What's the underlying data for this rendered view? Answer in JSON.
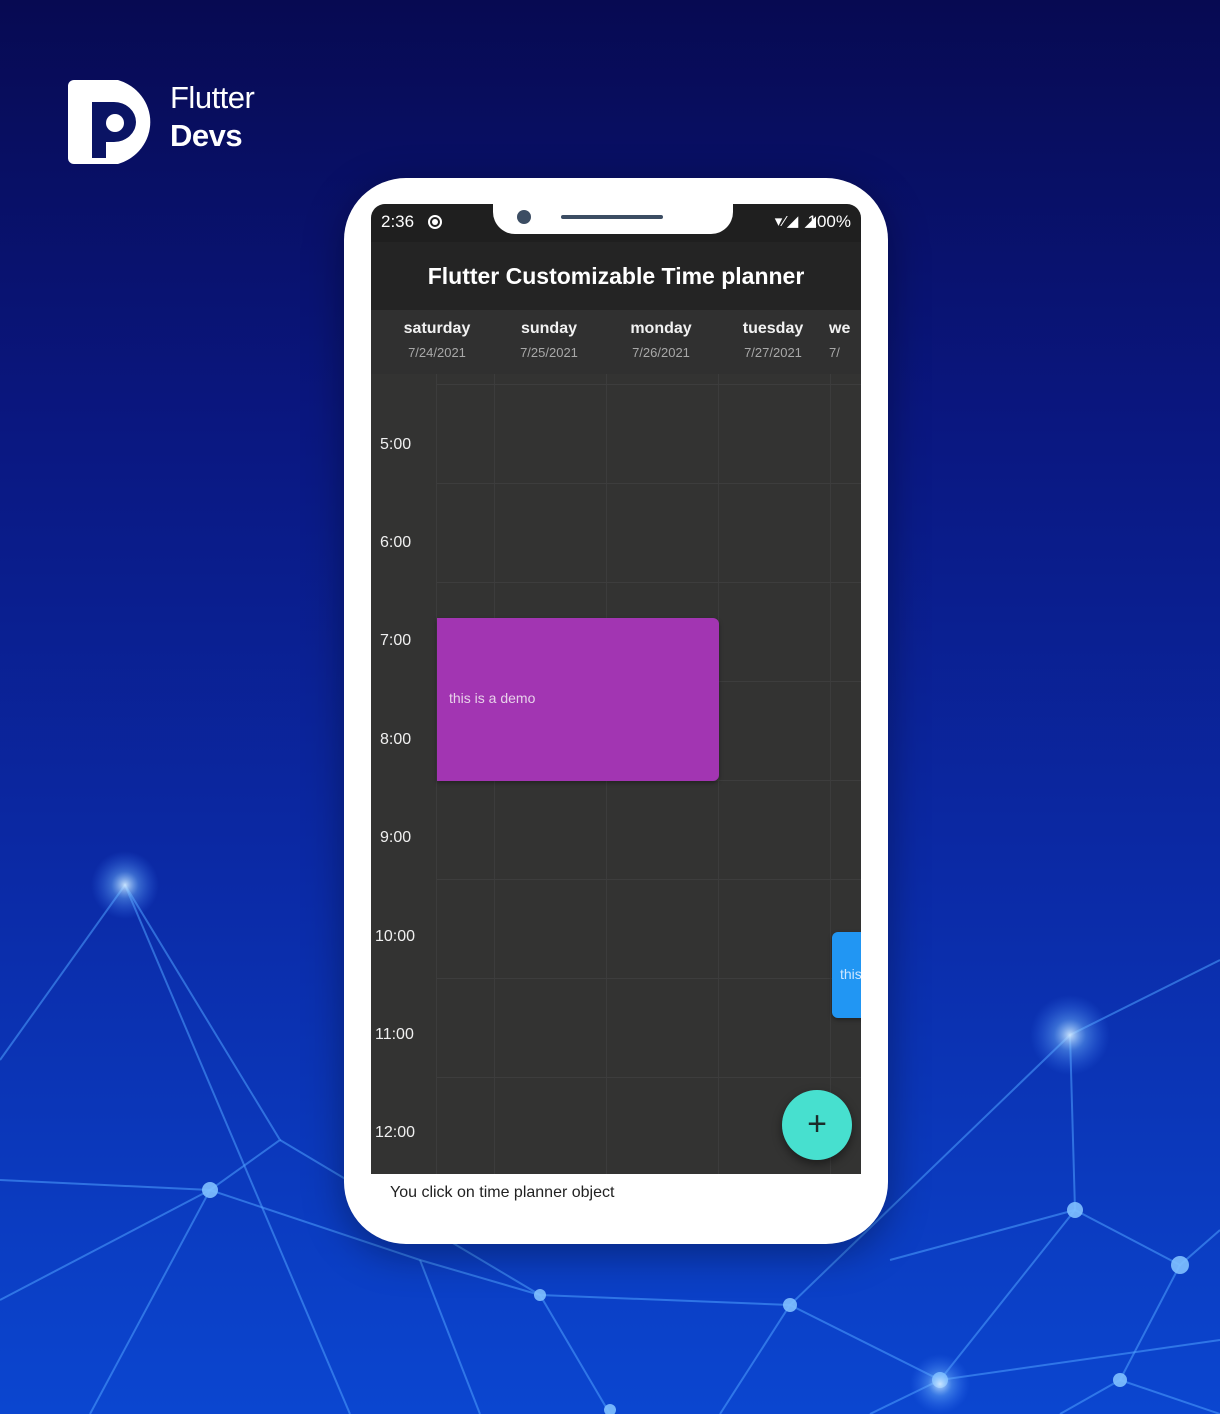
{
  "brand": {
    "line1": "Flutter",
    "line2": "Devs"
  },
  "status_bar": {
    "time": "2:36",
    "signal_icons": "▾⁄◢ ◢",
    "battery": "100%"
  },
  "app_bar": {
    "title": "Flutter Customizable Time planner"
  },
  "days": [
    {
      "name": "saturday",
      "date": "7/24/2021"
    },
    {
      "name": "sunday",
      "date": "7/25/2021"
    },
    {
      "name": "monday",
      "date": "7/26/2021"
    },
    {
      "name": "tuesday",
      "date": "7/27/2021"
    },
    {
      "name": "we",
      "date": "7/"
    }
  ],
  "hours": [
    "5:00",
    "6:00",
    "7:00",
    "8:00",
    "9:00",
    "10:00",
    "11:00",
    "12:00"
  ],
  "events": [
    {
      "label": "this is a demo",
      "color": "#a235b2"
    },
    {
      "label": "this",
      "color": "#2196f3"
    }
  ],
  "fab": {
    "icon": "plus-icon",
    "glyph": "+"
  },
  "snackbar": {
    "message": "You click on time planner object"
  },
  "colors": {
    "planner_bg": "#333332",
    "appbar_bg": "#242424",
    "fab": "#47e0cf"
  }
}
